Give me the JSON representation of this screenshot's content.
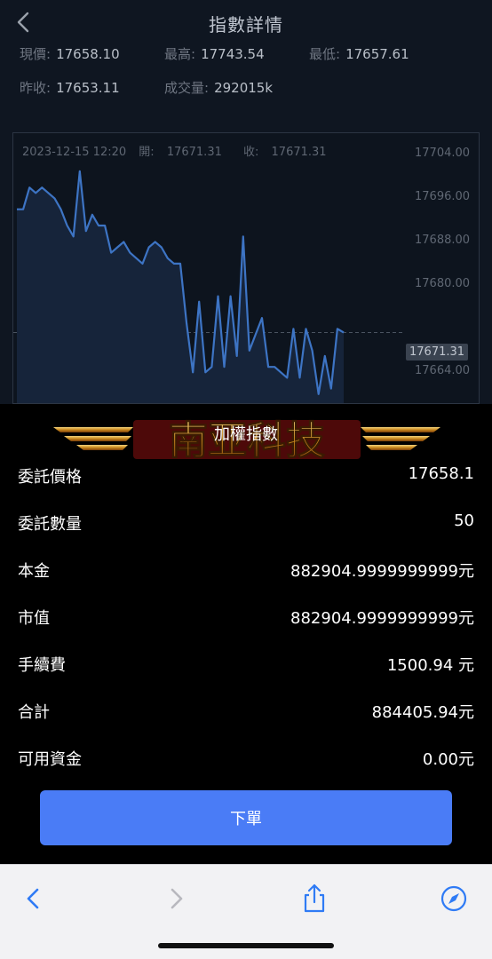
{
  "header": {
    "title": "指數詳情"
  },
  "quote": {
    "current_label": "現價:",
    "current": "17658.10",
    "high_label": "最高:",
    "high": "17743.54",
    "low_label": "最低:",
    "low": "17657.61",
    "prev_label": "昨收:",
    "prev": "17653.11",
    "volume_label": "成交量:",
    "volume": "292015k"
  },
  "chart": {
    "datetime": "2023-12-15 12:20",
    "open_label": "開:",
    "open": "17671.31",
    "close_label": "收:",
    "close": "17671.31",
    "last_tag": "17671.31",
    "line_color": "#3d74c4",
    "fill_color": "#16243a"
  },
  "chart_data": {
    "type": "area",
    "y_ticks": [
      "17704.00",
      "17696.00",
      "17688.00",
      "17680.00",
      "17664.00"
    ],
    "ylim": [
      17658,
      17708
    ],
    "values": [
      17694,
      17694,
      17698,
      17697,
      17698,
      17697,
      17696,
      17694,
      17691,
      17689,
      17701,
      17690,
      17693,
      17691,
      17691,
      17686,
      17687,
      17688,
      17686,
      17685,
      17684,
      17687,
      17688,
      17687,
      17685,
      17684,
      17684,
      17673,
      17664,
      17677,
      17664,
      17665,
      17678,
      17665,
      17678,
      17667,
      17689,
      17668,
      17671,
      17674,
      17665,
      17665,
      17664,
      17663,
      17672,
      17663,
      17672,
      17668,
      17660,
      17667,
      17661,
      17672,
      17671.31
    ]
  },
  "sheet": {
    "watermark_text": "南亚科技",
    "title": "加權指數",
    "rows": [
      {
        "label": "委託價格",
        "value": "17658.1"
      },
      {
        "label": "委託數量",
        "value": "50"
      },
      {
        "label": "本金",
        "value": "882904.9999999999元"
      },
      {
        "label": "市值",
        "value": "882904.9999999999元"
      },
      {
        "label": "手續費",
        "value": "1500.94 元"
      },
      {
        "label": "合計",
        "value": "884405.94元"
      },
      {
        "label": "可用資金",
        "value": "0.00元"
      }
    ],
    "order_button": "下單"
  },
  "toolbar": {
    "icons": [
      "back-icon",
      "forward-icon",
      "share-icon",
      "compass-icon"
    ],
    "accent": "#2f7bf5"
  }
}
